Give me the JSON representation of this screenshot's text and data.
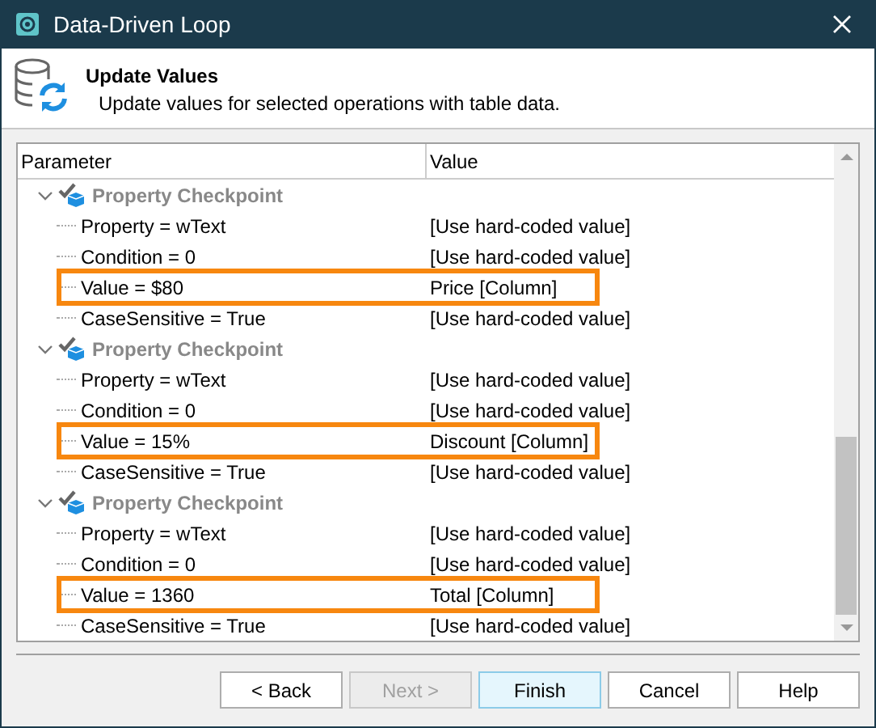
{
  "window": {
    "title": "Data-Driven Loop"
  },
  "header": {
    "title": "Update Values",
    "subtitle": "Update values for selected operations with table data."
  },
  "table": {
    "columns": [
      "Parameter",
      "Value"
    ],
    "groups": [
      {
        "label": "Property Checkpoint",
        "expanded": true,
        "rows": [
          {
            "parameter": "Property = wText",
            "value": "[Use hard-coded value]",
            "highlighted": false
          },
          {
            "parameter": "Condition = 0",
            "value": "[Use hard-coded value]",
            "highlighted": false
          },
          {
            "parameter": "Value = $80",
            "value": "Price [Column]",
            "highlighted": true
          },
          {
            "parameter": "CaseSensitive = True",
            "value": "[Use hard-coded value]",
            "highlighted": false
          }
        ]
      },
      {
        "label": "Property Checkpoint",
        "expanded": true,
        "rows": [
          {
            "parameter": "Property = wText",
            "value": "[Use hard-coded value]",
            "highlighted": false
          },
          {
            "parameter": "Condition = 0",
            "value": "[Use hard-coded value]",
            "highlighted": false
          },
          {
            "parameter": "Value = 15%",
            "value": "Discount [Column]",
            "highlighted": true
          },
          {
            "parameter": "CaseSensitive = True",
            "value": "[Use hard-coded value]",
            "highlighted": false
          }
        ]
      },
      {
        "label": "Property Checkpoint",
        "expanded": true,
        "rows": [
          {
            "parameter": "Property = wText",
            "value": "[Use hard-coded value]",
            "highlighted": false
          },
          {
            "parameter": "Condition = 0",
            "value": "[Use hard-coded value]",
            "highlighted": false
          },
          {
            "parameter": "Value = 1360",
            "value": "Total [Column]",
            "highlighted": true
          },
          {
            "parameter": "CaseSensitive = True",
            "value": "[Use hard-coded value]",
            "highlighted": false
          }
        ]
      }
    ]
  },
  "buttons": [
    {
      "label": "< Back",
      "disabled": false,
      "default": false
    },
    {
      "label": "Next >",
      "disabled": true,
      "default": false
    },
    {
      "label": "Finish",
      "disabled": false,
      "default": true
    },
    {
      "label": "Cancel",
      "disabled": false,
      "default": false
    },
    {
      "label": "Help",
      "disabled": false,
      "default": false
    }
  ]
}
